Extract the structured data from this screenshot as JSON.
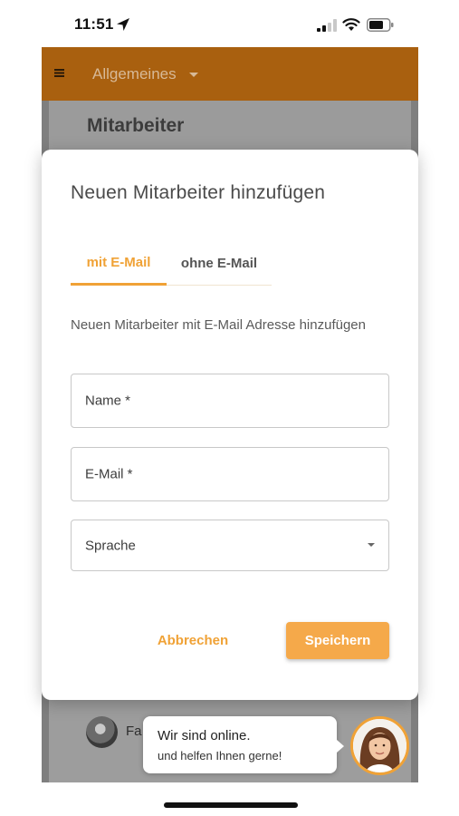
{
  "status_bar": {
    "time": "11:51",
    "icons": [
      "location-arrow-icon",
      "cellular-signal-icon",
      "wifi-icon",
      "battery-icon"
    ]
  },
  "app": {
    "header": {
      "menu_icon": "hamburger-menu-icon",
      "module_select_value": "Allgemeines",
      "header_color": "#a9600f"
    },
    "page_title": "Mitarbeiter",
    "list_preview_text": "Fa"
  },
  "dialog": {
    "title": "Neuen Mitarbeiter hinzufügen",
    "tabs": [
      {
        "label": "mit E-Mail",
        "active": true
      },
      {
        "label": "ohne E-Mail",
        "active": false
      }
    ],
    "description": "Neuen Mitarbeiter mit E-Mail Adresse hinzufügen",
    "fields": {
      "name": {
        "label": "Name *",
        "value": ""
      },
      "email": {
        "label": "E-Mail *",
        "value": ""
      },
      "language": {
        "label": "Sprache",
        "value": ""
      }
    },
    "buttons": {
      "cancel": "Abbrechen",
      "save": "Speichern"
    },
    "accent_color": "#f0a236"
  },
  "chat_widget": {
    "title": "Wir sind online.",
    "subtitle": "und helfen Ihnen gerne!",
    "avatar_icon": "support-agent-avatar"
  }
}
